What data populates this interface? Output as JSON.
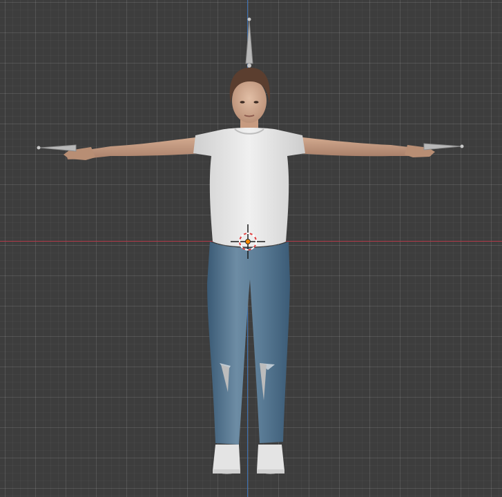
{
  "viewport": {
    "view": "front-orthographic",
    "background_color": "#3d3d3d",
    "grid_color": "#555555",
    "x_axis_color": "#b23a48",
    "z_axis_color": "#3a6fb2"
  },
  "scene": {
    "character": {
      "pose": "T-pose",
      "shirt_color": "#e6e6e6",
      "jeans_color": "#4a6f8c",
      "skin_color": "#c49a80",
      "hair_color": "#5a3c2c",
      "shoe_color": "#e8e8e8"
    },
    "armature_bones": [
      "head-bone-icon",
      "left-hand-bone-icon",
      "right-hand-bone-icon",
      "left-knee-bone-icon",
      "right-knee-bone-icon"
    ],
    "cursor": "3d-cursor-icon",
    "origin_color": "#ff8a00"
  }
}
